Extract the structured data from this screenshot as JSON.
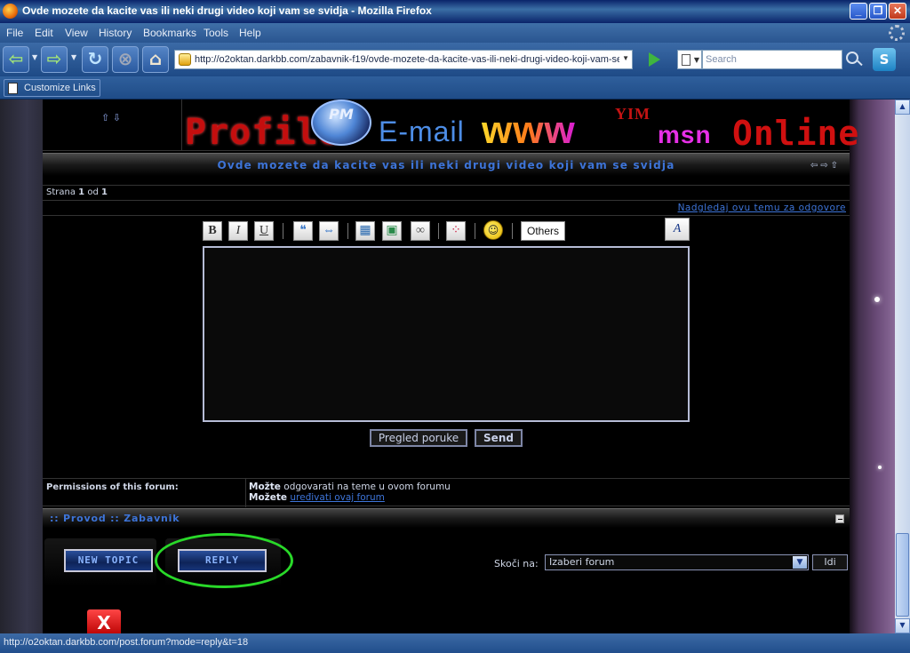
{
  "window": {
    "title": "Ovde mozete da kacite vas ili neki drugi video koji vam se svidja - Mozilla Firefox"
  },
  "menu": [
    "File",
    "Edit",
    "View",
    "History",
    "Bookmarks",
    "Tools",
    "Help"
  ],
  "nav": {
    "url": "http://o2oktan.darkbb.com/zabavnik-f19/ovde-mozete-da-kacite-vas-ili-neki-drugi-video-koji-vam-se-",
    "search_placeholder": "Search"
  },
  "bookmarks": {
    "customize_label": "Customize Links"
  },
  "profile_buttons": {
    "profile": "Profile",
    "pm": "PM",
    "email": "E-mail",
    "www": "www",
    "yim": "YIM",
    "msn": "msn",
    "online": "Online"
  },
  "topic": {
    "title": "Ovde mozete da kacite vas ili neki drugi video koji vam se svidja",
    "strana_label": "Strana",
    "page_current": "1",
    "page_sep": "od",
    "page_total": "1",
    "watch_link": "Nadgledaj ovu temu za odgovore"
  },
  "editor": {
    "bold": "B",
    "italic": "I",
    "underline": "U",
    "others_label": "Others",
    "preview_label": "Pregled poruke",
    "send_label": "Send"
  },
  "permissions": {
    "label": "Permissions of this forum:",
    "line1_bold": "Možte",
    "line1_rest": "odgovarati na teme u ovom forumu",
    "line2_bold": "Možete",
    "line2_link": "uređivati ovaj forum"
  },
  "breadcrumb": {
    "sep": "::",
    "item1": "Provod",
    "item2": "Zabavnik"
  },
  "buttons": {
    "new_topic": "NEW TOPIC",
    "reply": "REPLY"
  },
  "jump": {
    "label": "Skoči na:",
    "select_value": "Izaberi forum",
    "go_label": "Idi"
  },
  "status": {
    "text": "http://o2oktan.darkbb.com/post.forum?mode=reply&t=18"
  }
}
